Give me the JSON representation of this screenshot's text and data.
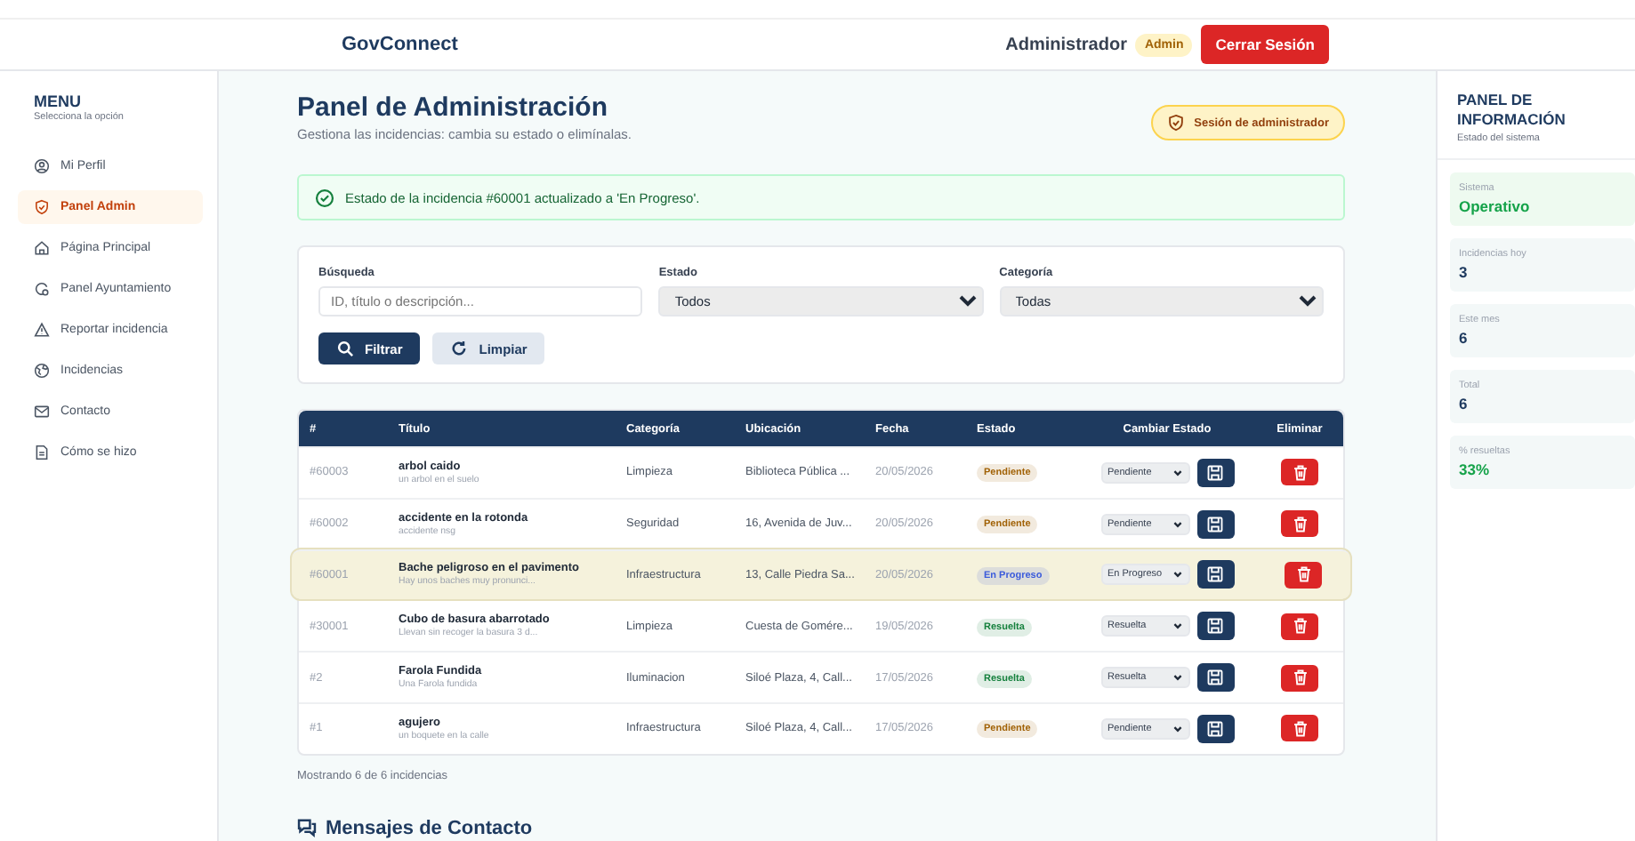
{
  "header": {
    "brand": "GovConnect",
    "user": "Administrador",
    "role_badge": "Admin",
    "logout": "Cerrar Sesión"
  },
  "sidebar": {
    "title": "MENU",
    "subtitle": "Selecciona la opción",
    "items": [
      {
        "label": "Mi Perfil",
        "selected": false
      },
      {
        "label": "Panel Admin",
        "selected": true
      },
      {
        "label": "Página Principal",
        "selected": false
      },
      {
        "label": "Panel Ayuntamiento",
        "selected": false
      },
      {
        "label": "Reportar incidencia",
        "selected": false
      },
      {
        "label": "Incidencias",
        "selected": false
      },
      {
        "label": "Contacto",
        "selected": false
      },
      {
        "label": "Cómo se hizo",
        "selected": false
      }
    ]
  },
  "page": {
    "title": "Panel de Administración",
    "subtitle": "Gestiona las incidencias: cambia su estado o elimínalas.",
    "session_badge": "Sesión de administrador",
    "alert": "Estado de la incidencia #60001 actualizado a 'En Progreso'."
  },
  "filters": {
    "search_label": "Búsqueda",
    "search_placeholder": "ID, título o descripción...",
    "state_label": "Estado",
    "state_value": "Todos",
    "category_label": "Categoría",
    "category_value": "Todas",
    "filter_button": "Filtrar",
    "clear_button": "Limpiar"
  },
  "table": {
    "columns": [
      "#",
      "Título",
      "Categoría",
      "Ubicación",
      "Fecha",
      "Estado",
      "Cambiar Estado",
      "Eliminar"
    ],
    "rows": [
      {
        "id": "#60003",
        "title": "arbol caido",
        "description": "un arbol en el suelo",
        "category": "Limpieza",
        "location": "Biblioteca Pública ...",
        "date": "20/05/2026",
        "status": "Pendiente",
        "color": "#a16207",
        "new_status": "Pendiente",
        "selected": false
      },
      {
        "id": "#60002",
        "title": "accidente en la rotonda",
        "description": "accidente nsg",
        "category": "Seguridad",
        "location": "16, Avenida de Juv...",
        "date": "20/05/2026",
        "status": "Pendiente",
        "color": "#a16207",
        "new_status": "Pendiente",
        "selected": false
      },
      {
        "id": "#60001",
        "title": "Bache peligroso en el pavimento",
        "description": "Hay unos baches muy pronunci...",
        "category": "Infraestructura",
        "location": "13, Calle Piedra Sa...",
        "date": "20/05/2026",
        "status": "En Progreso",
        "color": "#3b5bdb",
        "new_status": "En Progreso",
        "selected": true
      },
      {
        "id": "#30001",
        "title": "Cubo de basura abarrotado",
        "description": "Llevan sin recoger la basura 3 d...",
        "category": "Limpieza",
        "location": "Cuesta de Gomére...",
        "date": "19/05/2026",
        "status": "Resuelta",
        "color": "#15803d",
        "new_status": "Resuelta",
        "selected": false
      },
      {
        "id": "#2",
        "title": "Farola Fundida",
        "description": "Una Farola fundida",
        "category": "Iluminacion",
        "location": "Siloé Plaza, 4, Call...",
        "date": "17/05/2026",
        "status": "Resuelta",
        "color": "#15803d",
        "new_status": "Resuelta",
        "selected": false
      },
      {
        "id": "#1",
        "title": "agujero",
        "description": "un boquete en la calle",
        "category": "Infraestructura",
        "location": "Siloé Plaza, 4, Call...",
        "date": "17/05/2026",
        "status": "Pendiente",
        "color": "#a16207",
        "new_status": "Pendiente",
        "selected": false
      }
    ],
    "footer": "Mostrando 6 de 6 incidencias"
  },
  "messages": {
    "title": "Mensajes de Contacto"
  },
  "info_panel": {
    "title": "PANEL DE INFORMACIÓN",
    "subtitle": "Estado del sistema",
    "stats": [
      {
        "label": "Sistema",
        "value": "Operativo",
        "kind": "status"
      },
      {
        "label": "Incidencias hoy",
        "value": "3",
        "kind": "count"
      },
      {
        "label": "Este mes",
        "value": "6",
        "kind": "count"
      },
      {
        "label": "Total",
        "value": "6",
        "kind": "count"
      },
      {
        "label": "% resueltas",
        "value": "33%",
        "kind": "percent"
      }
    ]
  }
}
